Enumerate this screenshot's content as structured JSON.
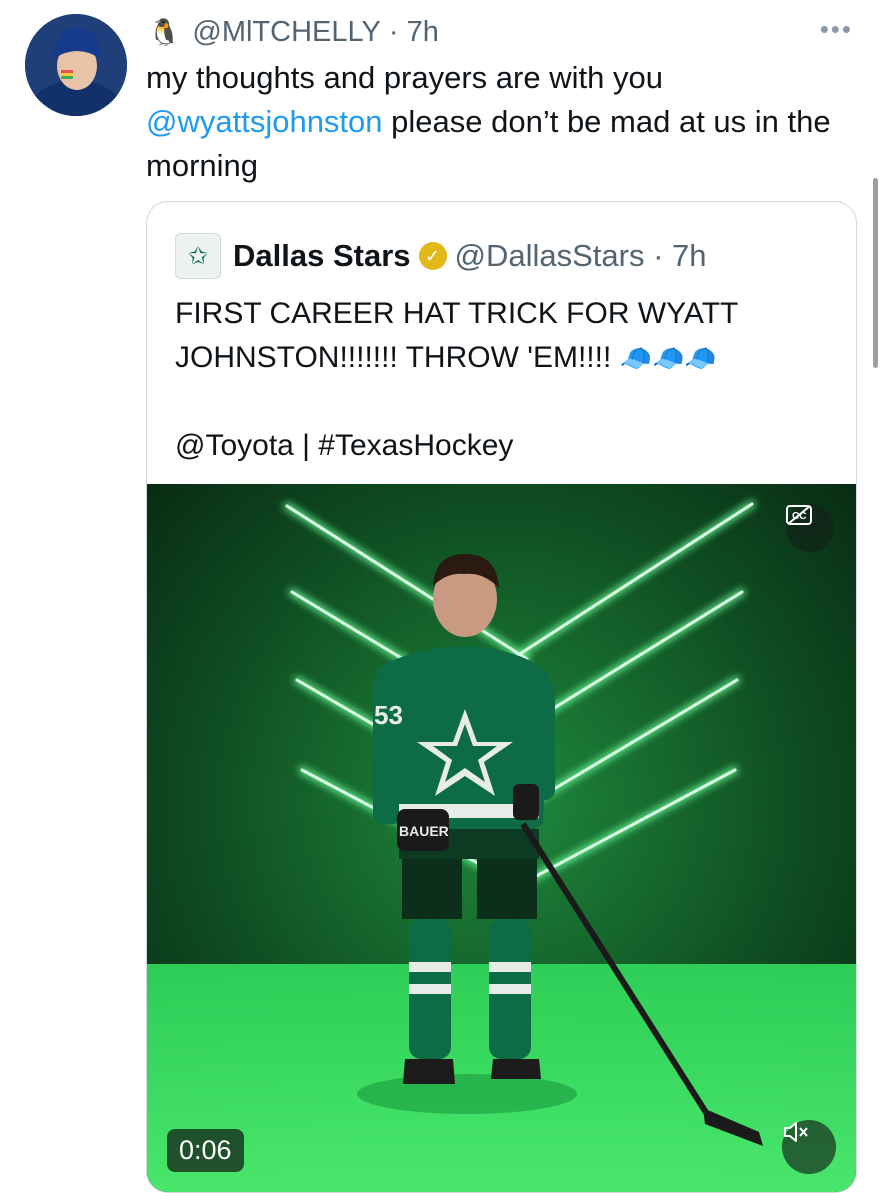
{
  "tweet": {
    "author_emoji": "🐧",
    "handle": "@MlTCHELLY",
    "separator": " · ",
    "time": "7h",
    "more_label": "•••",
    "text_part1": "my thoughts and prayers are with you ",
    "mention": "@wyattsjohnston",
    "text_part2": " please don’t be mad at us in the morning"
  },
  "quote": {
    "avatar_icon": "star-logo",
    "name": "Dallas Stars",
    "badge": "verified-gold-icon",
    "badge_glyph": "✓",
    "handle": "@DallasStars",
    "separator": " · ",
    "time": "7h",
    "line1": "FIRST CAREER HAT TRICK FOR WYATT JOHNSTON!!!!!!! THROW 'EM!!!! ",
    "caps": "🧢🧢🧢",
    "line2": "@Toyota | #TexasHockey"
  },
  "video": {
    "timestamp": "0:06",
    "jersey_number": "53",
    "glove_brand": "BAUER",
    "cc_icon": "captions-off-icon",
    "mute_icon": "speaker-muted-icon",
    "colors": {
      "neon": "#6dff9a",
      "jersey": "#0d6b45"
    }
  }
}
